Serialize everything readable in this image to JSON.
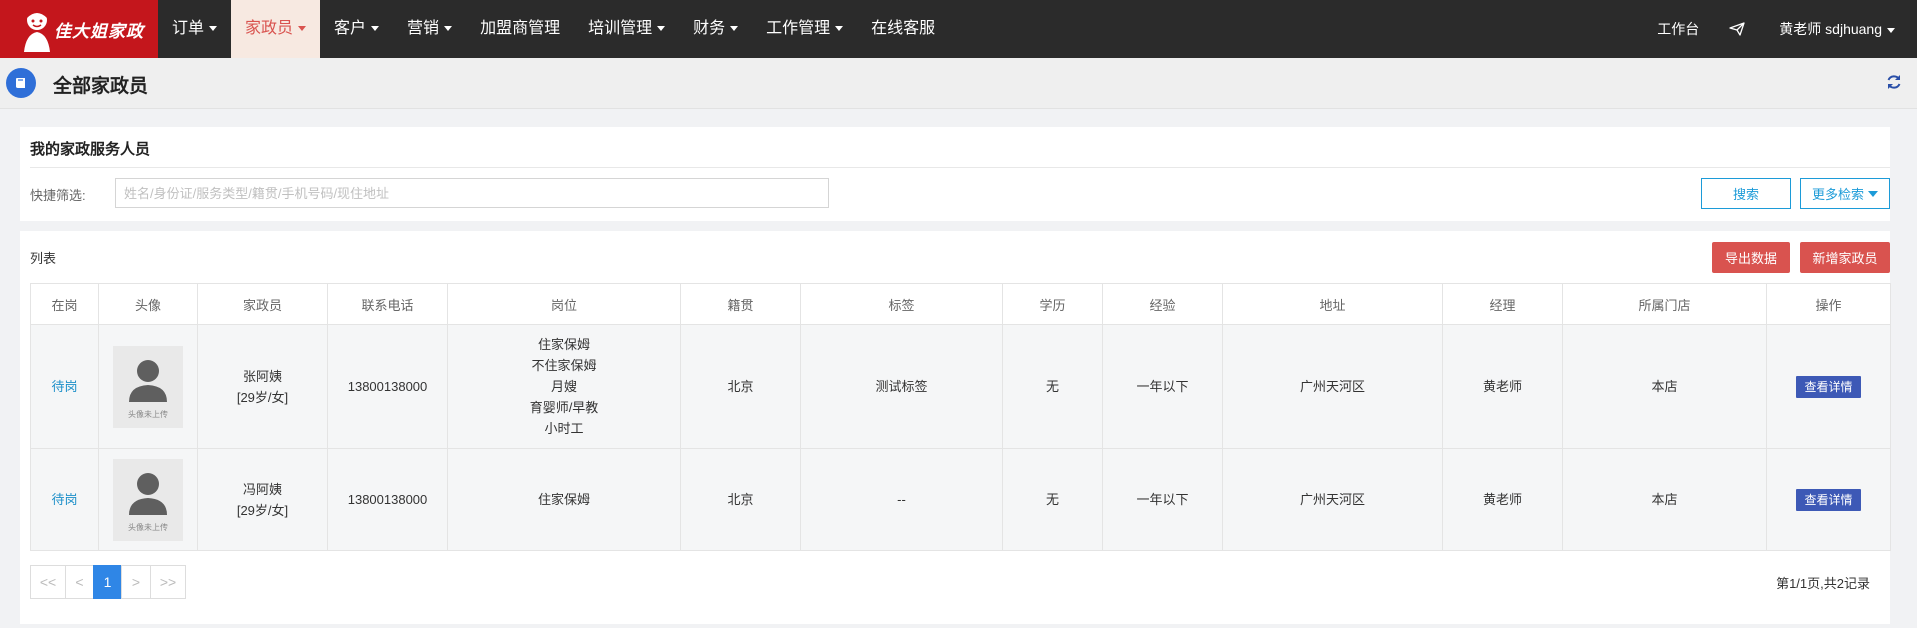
{
  "logo": {
    "brand_text": "佳大姐家政"
  },
  "nav": {
    "items": [
      {
        "label": "订单",
        "dropdown": true
      },
      {
        "label": "家政员",
        "dropdown": true,
        "active": true
      },
      {
        "label": "客户",
        "dropdown": true
      },
      {
        "label": "营销",
        "dropdown": true
      },
      {
        "label": "加盟商管理",
        "dropdown": false
      },
      {
        "label": "培训管理",
        "dropdown": true
      },
      {
        "label": "财务",
        "dropdown": true
      },
      {
        "label": "工作管理",
        "dropdown": true
      },
      {
        "label": "在线客服",
        "dropdown": false
      }
    ],
    "workbench": "工作台",
    "user": "黄老师 sdjhuang"
  },
  "page": {
    "title": "全部家政员"
  },
  "filter": {
    "panel_title": "我的家政服务人员",
    "quick_label": "快捷筛选:",
    "placeholder": "姓名/身份证/服务类型/籍贯/手机号码/现住地址",
    "value": "",
    "search_button": "搜索",
    "more_button": "更多检索"
  },
  "list": {
    "title": "列表",
    "export_button": "导出数据",
    "add_button": "新增家政员",
    "columns": [
      "在岗",
      "头像",
      "家政员",
      "联系电话",
      "岗位",
      "籍贯",
      "标签",
      "学历",
      "经验",
      "地址",
      "经理",
      "所属门店",
      "操作"
    ],
    "avatar_text": "头像未上传",
    "detail_button": "查看详情",
    "rows": [
      {
        "status": "待岗",
        "name": "张阿姨",
        "info": "[29岁/女]",
        "phone": "13800138000",
        "positions": [
          "住家保姆",
          "不住家保姆",
          "月嫂",
          "育婴师/早教",
          "小时工"
        ],
        "hometown": "北京",
        "tag": "测试标签",
        "education": "无",
        "experience": "一年以下",
        "address": "广州天河区",
        "manager": "黄老师",
        "store": "本店"
      },
      {
        "status": "待岗",
        "name": "冯阿姨",
        "info": "[29岁/女]",
        "phone": "13800138000",
        "positions": [
          "住家保姆"
        ],
        "hometown": "北京",
        "tag": "--",
        "education": "无",
        "experience": "一年以下",
        "address": "广州天河区",
        "manager": "黄老师",
        "store": "本店"
      }
    ]
  },
  "pagination": {
    "buttons": [
      "<<",
      "<",
      "1",
      ">",
      ">>"
    ],
    "current": "1",
    "info": "第1/1页,共2记录"
  },
  "colors": {
    "nav_bg": "#2b2b2b",
    "logo_bg": "#c4161c",
    "accent_red": "#d9534f",
    "link_blue": "#1c8fc9",
    "detail_btn": "#3d59b6",
    "page_active": "#2f86e6"
  }
}
